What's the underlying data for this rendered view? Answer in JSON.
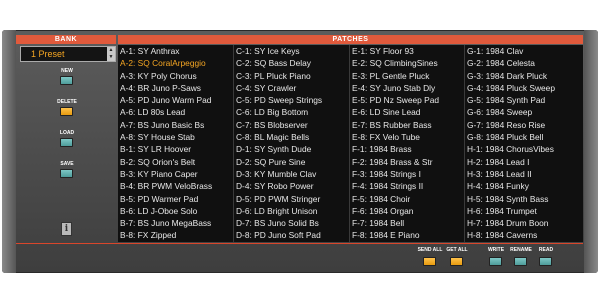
{
  "bank": {
    "header": "BANK",
    "selected": "1 Preset",
    "buttons": {
      "new": "NEW",
      "delete": "DELETE",
      "load": "LOAD",
      "save": "SAVE"
    }
  },
  "patches": {
    "header": "PATCHES",
    "columns": [
      [
        "A-1: SY Anthrax",
        "A-2: SQ CoralArpeggio",
        "A-3: KY Poly Chorus",
        "A-4: BR Juno P-Saws",
        "A-5: PD Juno Warm Pad",
        "A-6: LD 80s Lead",
        "A-7: BS Juno Basic Bs",
        "A-8: SY House Stab",
        "B-1: SY LR Hoover",
        "B-2: SQ Orion's Belt",
        "B-3: KY Piano Caper",
        "B-4: BR PWM VeloBrass",
        "B-5: PD Warmer Pad",
        "B-6: LD J-Oboe Solo",
        "B-7: BS Juno MegaBass",
        "B-8: FX Zipped"
      ],
      [
        "C-1: SY Ice Keys",
        "C-2: SQ Bass Delay",
        "C-3: PL Pluck Piano",
        "C-4: SY Crawler",
        "C-5: PD Sweep Strings",
        "C-6: LD Big Bottom",
        "C-7: BS Blobserver",
        "C-8: BL Magic Bells",
        "D-1: SY Synth Dude",
        "D-2: SQ Pure Sine",
        "D-3: KY Mumble Clav",
        "D-4: SY Robo Power",
        "D-5: PD PWM Stringer",
        "D-6: LD Bright Unison",
        "D-7: BS Juno Solid Bs",
        "D-8: PD Juno Soft Pad"
      ],
      [
        "E-1: SY Floor 93",
        "E-2: SQ ClimbingSines",
        "E-3: PL Gentle Pluck",
        "E-4: SY Juno Stab Dly",
        "E-5: PD Nz Sweep Pad",
        "E-6: LD Sine Lead",
        "E-7: BS Rubber Bass",
        "E-8: FX Velo Tube",
        "F-1: 1984 Brass",
        "F-2: 1984 Brass & Str",
        "F-3: 1984 Strings I",
        "F-4: 1984 Strings II",
        "F-5: 1984 Choir",
        "F-6: 1984 Organ",
        "F-7: 1984 Bell",
        "F-8: 1984 E Piano"
      ],
      [
        "G-1: 1984 Clav",
        "G-2: 1984 Celesta",
        "G-3: 1984 Dark Pluck",
        "G-4: 1984 Pluck Sweep",
        "G-5: 1984 Synth Pad",
        "G-6: 1984 Sweep",
        "G-7: 1984 Reso Rise",
        "G-8: 1984 Pluck Bell",
        "H-1: 1984 ChorusVibes",
        "H-2: 1984 Lead I",
        "H-3: 1984 Lead II",
        "H-4: 1984 Funky",
        "H-5: 1984 Synth Bass",
        "H-6: 1984 Trumpet",
        "H-7: 1984 Drum Boon",
        "H-8: 1984 Caverns"
      ]
    ],
    "selected": "A-2: SQ CoralArpeggio"
  },
  "bottom_buttons": {
    "send_all": "SEND ALL",
    "get_all": "GET ALL",
    "write": "WRITE",
    "rename": "RENAME",
    "read": "READ"
  },
  "colors": {
    "accent_red": "#e05a3c",
    "selection_orange": "#f5a623",
    "button_teal": "#5fb0ae",
    "button_orange": "#f2a81e"
  }
}
